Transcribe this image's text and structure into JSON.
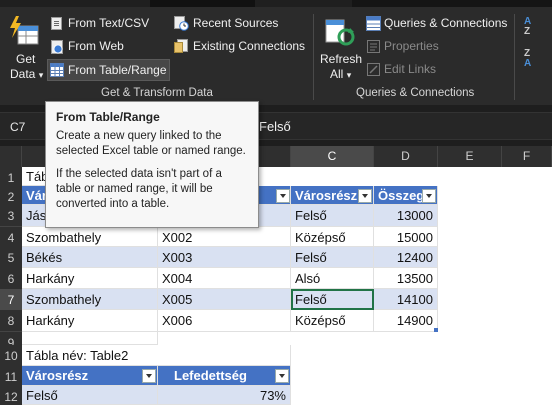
{
  "ribbon": {
    "get_data": {
      "line1": "Get",
      "line2": "Data",
      "arrow": "▾"
    },
    "from_text_csv": "From Text/CSV",
    "from_web": "From Web",
    "from_table_range": "From Table/Range",
    "recent_sources": "Recent Sources",
    "existing_connections": "Existing Connections",
    "group_get_transform": "Get & Transform Data",
    "refresh": {
      "line1": "Refresh",
      "line2": "All",
      "arrow": "▾"
    },
    "queries_connections": "Queries & Connections",
    "properties": "Properties",
    "edit_links": "Edit Links",
    "group_queries": "Queries & Connections"
  },
  "namebox": {
    "value": "C7"
  },
  "formula": {
    "value": "Felső"
  },
  "tooltip": {
    "title": "From Table/Range",
    "p1": "Create a new query linked to the selected Excel table or named range.",
    "p2": "If the selected data isn't part of a table or named range, it will be converted into a table."
  },
  "columns": [
    "A",
    "B",
    "C",
    "D",
    "E",
    "F"
  ],
  "rows": [
    "1",
    "2",
    "3",
    "4",
    "5",
    "6",
    "7",
    "8",
    "9",
    "10",
    "11",
    "12"
  ],
  "sheet": {
    "a1": "Tábl",
    "a2": "Váro",
    "c2": "Városrész",
    "d2": "Összeg",
    "r3": [
      "Jás",
      "",
      "Felső",
      "13000"
    ],
    "r4": [
      "Szombathely",
      "X002",
      "Középső",
      "15000"
    ],
    "r5": [
      "Békés",
      "X003",
      "Felső",
      "12400"
    ],
    "r6": [
      "Harkány",
      "X004",
      "Alsó",
      "13500"
    ],
    "r7": [
      "Szombathely",
      "X005",
      "Felső",
      "14100"
    ],
    "r8": [
      "Harkány",
      "X006",
      "Középső",
      "14900"
    ],
    "a10": "Tábla név: Table2",
    "a11": "Városrész",
    "b11": "Lefedettség",
    "a12": "Felső",
    "b12": "73%"
  },
  "colors": {
    "accent": "#217346",
    "table_header": "#4472c4",
    "table_band": "#d9e1f2"
  }
}
